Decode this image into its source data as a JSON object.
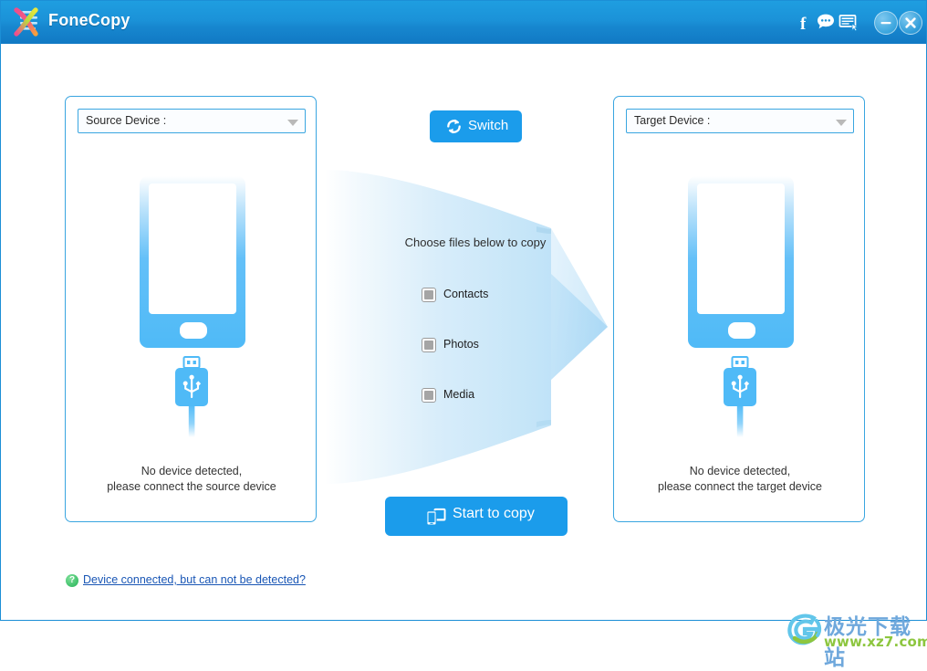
{
  "window": {
    "title": "FoneCopy",
    "logo_icon": "dna-helix-logo-icon"
  },
  "titlebar": {
    "icons": [
      {
        "name": "facebook-icon",
        "glyph": "f",
        "label": "Facebook"
      },
      {
        "name": "chat-bubble-icon",
        "glyph": "chat",
        "label": "Chat support"
      },
      {
        "name": "feedback-icon",
        "glyph": "form",
        "label": "Feedback"
      }
    ],
    "minimize_label": "Minimize",
    "close_label": "Close"
  },
  "source_panel": {
    "select_label": "Source Device :",
    "status_line1": "No device detected,",
    "status_line2": "please connect the source device",
    "phone_icon": "phone-outline-icon",
    "usb_icon": "usb-plug-icon"
  },
  "target_panel": {
    "select_label": "Target Device :",
    "status_line1": "No device detected,",
    "status_line2": "please connect the target device",
    "phone_icon": "phone-outline-icon",
    "usb_icon": "usb-plug-icon"
  },
  "center": {
    "switch_label": "Switch",
    "switch_icon": "refresh-circular-arrows-icon",
    "choose_files_text": "Choose files below to copy",
    "file_options": [
      {
        "label": "Contacts",
        "checked": false,
        "enabled": false
      },
      {
        "label": "Photos",
        "checked": false,
        "enabled": false
      },
      {
        "label": "Media",
        "checked": false,
        "enabled": false
      }
    ],
    "start_copy_label": "Start to copy",
    "start_copy_icon": "two-devices-icon",
    "arrow_icon": "right-arrow-banner-icon"
  },
  "footer": {
    "help_icon": "question-mark-icon",
    "help_glyph": "?",
    "help_link_text": "Device connected, but can not be detected?"
  },
  "watermark": {
    "cn_text": "极光下载站",
    "url_text": "www.xz7.com",
    "logo_icon": "g-swirl-logo-icon"
  },
  "colors": {
    "titlebar_blue": "#1b92d8",
    "accent_blue": "#1b9ceb",
    "panel_border": "#39a5e0",
    "phone_blue": "#4fbaf7",
    "link_blue": "#1956b5",
    "help_green": "#3fc06a",
    "checkbox_gray": "#a5a5a5",
    "watermark_cn": "#6fa8dc",
    "watermark_url": "#8dc63f"
  }
}
